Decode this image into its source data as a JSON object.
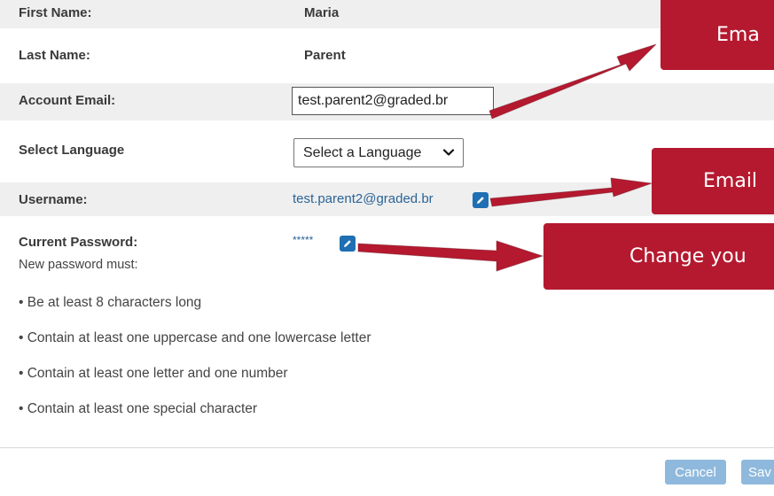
{
  "fields": {
    "first_name": {
      "label": "First Name:",
      "value": "Maria"
    },
    "last_name": {
      "label": "Last Name:",
      "value": "Parent"
    },
    "account_email": {
      "label": "Account Email:",
      "value": "test.parent2@graded.br"
    },
    "language": {
      "label": "Select Language",
      "selected": "Select a Language"
    },
    "username": {
      "label": "Username:",
      "value": "test.parent2@graded.br"
    },
    "password": {
      "label": "Current Password:",
      "value": "*****"
    }
  },
  "password_rules": {
    "intro": "New password must:",
    "items": [
      "• Be at least 8 characters long",
      "• Contain at least one uppercase and one lowercase letter",
      "• Contain at least one letter and one number",
      "• Contain at least one special character"
    ]
  },
  "buttons": {
    "cancel": "Cancel",
    "save": "Sav"
  },
  "callouts": {
    "email": "Ema",
    "username": "Email",
    "password": "Change you"
  },
  "colors": {
    "callout": "#b5192f",
    "link": "#2a6496",
    "edit_icon": "#1f6fb2",
    "button": "#8fb9dc"
  },
  "icons": {
    "edit": "pencil-icon",
    "dropdown": "chevron-down-icon"
  }
}
